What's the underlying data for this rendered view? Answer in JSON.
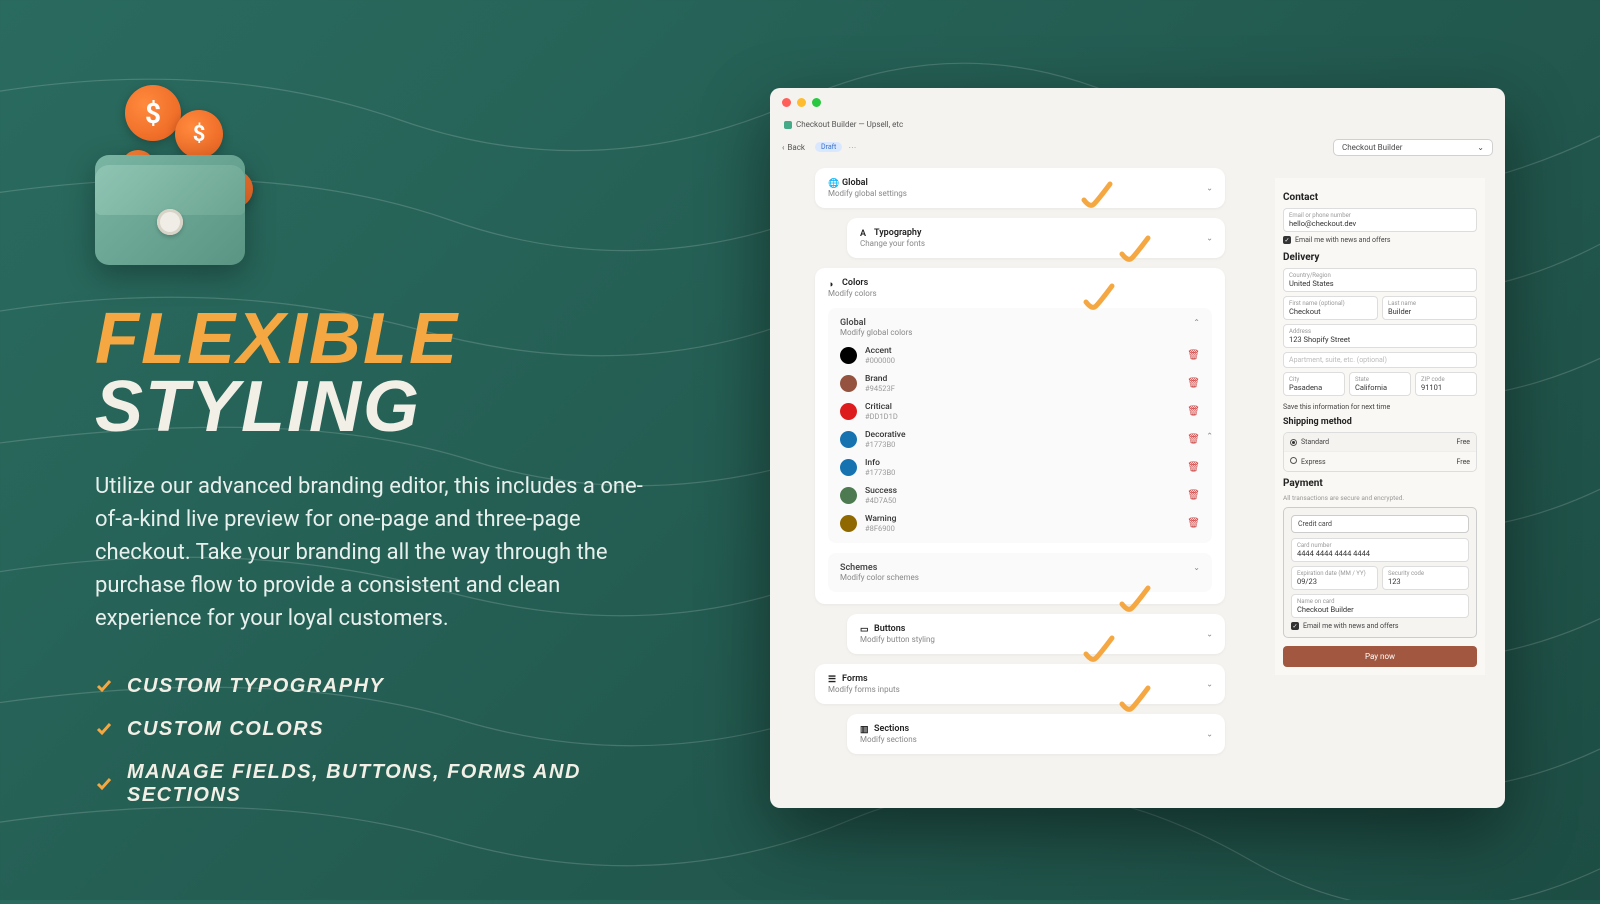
{
  "marketing": {
    "heading_l1": "FLEXIBLE",
    "heading_l2": "STYLING",
    "description": "Utilize our advanced branding editor, this includes a one-of-a-kind live preview for one-page and three-page checkout. Take your branding all the way through the purchase flow to provide a consistent and clean experience for your loyal customers.",
    "features": [
      "CUSTOM TYPOGRAPHY",
      "CUSTOM COLORS",
      "MANAGE FIELDS, BUTTONS, FORMS AND SECTIONS"
    ]
  },
  "app": {
    "title": "Checkout Builder — Upsell, etc",
    "back_label": "Back",
    "badge": "Draft",
    "selector_value": "Checkout Builder"
  },
  "panels": {
    "global": {
      "title": "Global",
      "sub": "Modify global settings"
    },
    "typography": {
      "title": "Typography",
      "sub": "Change your fonts"
    },
    "colors": {
      "title": "Colors",
      "sub": "Modify colors",
      "global_section": {
        "title": "Global",
        "sub": "Modify global colors"
      },
      "items": [
        {
          "name": "Accent",
          "hex": "#000000",
          "swatch": "#000000"
        },
        {
          "name": "Brand",
          "hex": "#94523F",
          "swatch": "#94523F"
        },
        {
          "name": "Critical",
          "hex": "#DD1D1D",
          "swatch": "#DD1D1D"
        },
        {
          "name": "Decorative",
          "hex": "#1773B0",
          "swatch": "#1773B0"
        },
        {
          "name": "Info",
          "hex": "#1773B0",
          "swatch": "#1773B0"
        },
        {
          "name": "Success",
          "hex": "#4D7A50",
          "swatch": "#4D7A50"
        },
        {
          "name": "Warning",
          "hex": "#8F6900",
          "swatch": "#8F6900"
        }
      ],
      "schemes": {
        "title": "Schemes",
        "sub": "Modify color schemes"
      }
    },
    "buttons": {
      "title": "Buttons",
      "sub": "Modify button styling"
    },
    "forms": {
      "title": "Forms",
      "sub": "Modify forms inputs"
    },
    "sections": {
      "title": "Sections",
      "sub": "Modify sections"
    }
  },
  "preview": {
    "contact": {
      "heading": "Contact",
      "email_label": "Email or phone number",
      "email_value": "hello@checkout.dev",
      "newsletter": "Email me with news and offers"
    },
    "delivery": {
      "heading": "Delivery",
      "country_label": "Country/Region",
      "country_value": "United States",
      "first_label": "First name (optional)",
      "first_value": "Checkout",
      "last_label": "Last name",
      "last_value": "Builder",
      "address_label": "Address",
      "address_value": "123 Shopify Street",
      "apt_placeholder": "Apartment, suite, etc. (optional)",
      "city_label": "City",
      "city_value": "Pasadena",
      "state_label": "State",
      "state_value": "California",
      "zip_label": "ZIP code",
      "zip_value": "91101",
      "save_info": "Save this information for next time"
    },
    "shipping": {
      "heading": "Shipping method",
      "standard": "Standard",
      "express": "Express",
      "free": "Free"
    },
    "payment": {
      "heading": "Payment",
      "note": "All transactions are secure and encrypted.",
      "method": "Credit card",
      "card_label": "Card number",
      "card_value": "4444 4444 4444 4444",
      "exp_label": "Expiration date (MM / YY)",
      "exp_value": "09/23",
      "cvv_label": "Security code",
      "cvv_value": "123",
      "name_label": "Name on card",
      "name_value": "Checkout Builder",
      "newsletter": "Email me with news and offers",
      "pay_button": "Pay now"
    }
  }
}
